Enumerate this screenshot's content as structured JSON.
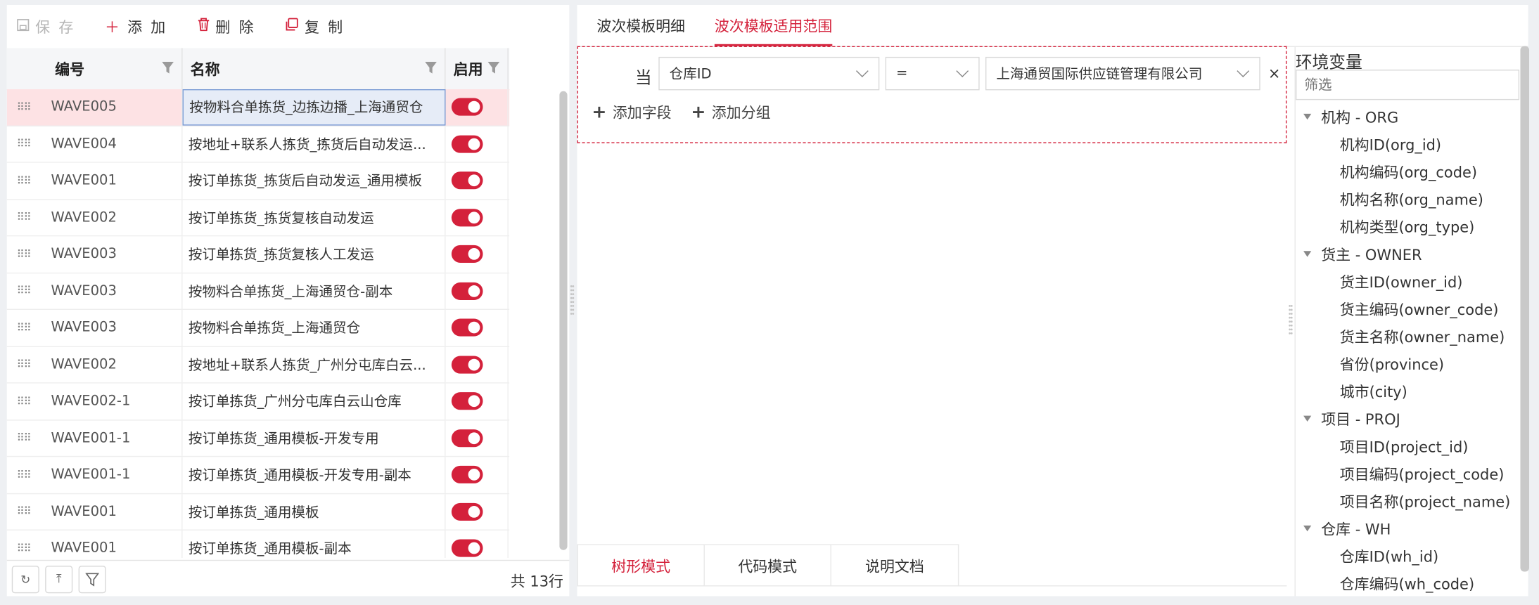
{
  "toolbar": {
    "save": "保 存",
    "add": "添 加",
    "delete": "删 除",
    "copy": "复 制"
  },
  "table": {
    "headers": {
      "code": "编号",
      "name": "名称",
      "enabled": "启用"
    },
    "rows": [
      {
        "code": "WAVE005",
        "name": "按物料合单拣货_边拣边播_上海通贸仓",
        "enabled": true,
        "selected": true
      },
      {
        "code": "WAVE004",
        "name": "按地址+联系人拣货_拣货后自动发运...",
        "enabled": true
      },
      {
        "code": "WAVE001",
        "name": "按订单拣货_拣货后自动发运_通用模板",
        "enabled": true
      },
      {
        "code": "WAVE002",
        "name": "按订单拣货_拣货复核自动发运",
        "enabled": true
      },
      {
        "code": "WAVE003",
        "name": "按订单拣货_拣货复核人工发运",
        "enabled": true
      },
      {
        "code": "WAVE003",
        "name": "按物料合单拣货_上海通贸仓-副本",
        "enabled": true
      },
      {
        "code": "WAVE003",
        "name": "按物料合单拣货_上海通贸仓",
        "enabled": true
      },
      {
        "code": "WAVE002",
        "name": "按地址+联系人拣货_广州分屯库白云...",
        "enabled": true
      },
      {
        "code": "WAVE002-1",
        "name": "按订单拣货_广州分屯库白云山仓库",
        "enabled": true
      },
      {
        "code": "WAVE001-1",
        "name": "按订单拣货_通用模板-开发专用",
        "enabled": true
      },
      {
        "code": "WAVE001-1",
        "name": "按订单拣货_通用模板-开发专用-副本",
        "enabled": true
      },
      {
        "code": "WAVE001",
        "name": "按订单拣货_通用模板",
        "enabled": true
      },
      {
        "code": "WAVE001",
        "name": "按订单拣货_通用模板-副本",
        "enabled": true
      }
    ],
    "total": "共 13行"
  },
  "tabs": {
    "detail": "波次模板明细",
    "scope": "波次模板适用范围"
  },
  "scope": {
    "when": "当",
    "field": "仓库ID",
    "operator": "=",
    "value": "上海通贸国际供应链管理有限公司",
    "close": "×",
    "add_field": "添加字段",
    "add_group": "添加分组"
  },
  "bottom_tabs": {
    "tree": "树形模式",
    "code": "代码模式",
    "docs": "说明文档"
  },
  "env": {
    "title": "环境变量",
    "filter_placeholder": "筛选",
    "groups": [
      {
        "label": "机构 - ORG",
        "items": [
          "机构ID(org_id)",
          "机构编码(org_code)",
          "机构名称(org_name)",
          "机构类型(org_type)"
        ]
      },
      {
        "label": "货主 - OWNER",
        "items": [
          "货主ID(owner_id)",
          "货主编码(owner_code)",
          "货主名称(owner_name)",
          "省份(province)",
          "城市(city)"
        ]
      },
      {
        "label": "项目 - PROJ",
        "items": [
          "项目ID(project_id)",
          "项目编码(project_code)",
          "项目名称(project_name)"
        ]
      },
      {
        "label": "仓库 - WH",
        "items": [
          "仓库ID(wh_id)",
          "仓库编码(wh_code)"
        ]
      }
    ]
  },
  "colors": {
    "accent": "#d4213b",
    "selected_row": "#fde2e4"
  }
}
